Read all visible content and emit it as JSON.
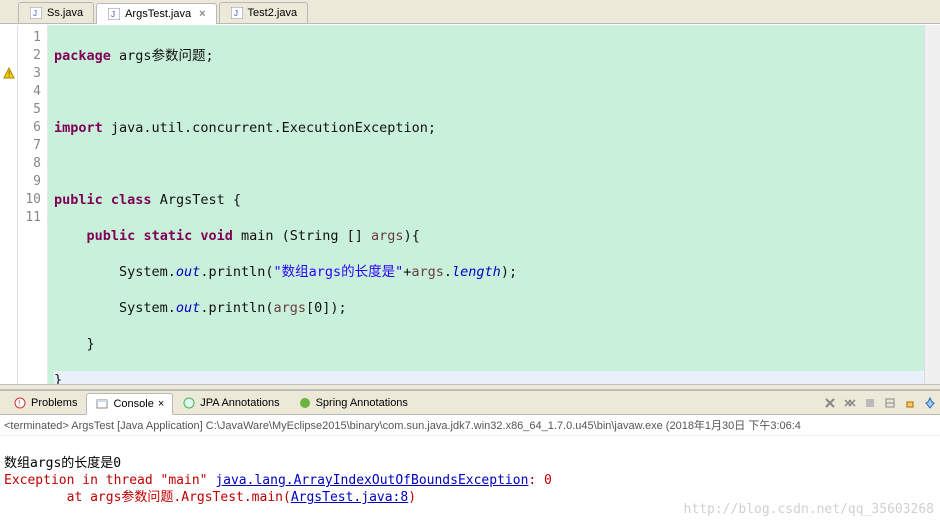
{
  "tabs": [
    {
      "label": "Ss.java",
      "active": false
    },
    {
      "label": "ArgsTest.java",
      "active": true
    },
    {
      "label": "Test2.java",
      "active": false
    }
  ],
  "gutter": [
    "1",
    "2",
    "3",
    "4",
    "5",
    "6",
    "7",
    "8",
    "9",
    "10",
    "11"
  ],
  "code": {
    "l1_kw1": "package",
    "l1_rest": " args参数问题;",
    "l3_kw1": "import",
    "l3_rest": " java.util.concurrent.ExecutionException;",
    "l5_kw1": "public",
    "l5_kw2": "class",
    "l5_rest1": " ArgsTest {",
    "l6_kw1": "public",
    "l6_kw2": "static",
    "l6_kw3": "void",
    "l6_rest1": " main (String [] ",
    "l6_var": "args",
    "l6_rest2": "){",
    "l7_pre": "        System.",
    "l7_fld": "out",
    "l7_mid": ".println(",
    "l7_str": "\"数组args的长度是\"",
    "l7_plus": "+",
    "l7_var": "args",
    "l7_mid2": ".",
    "l7_fld2": "length",
    "l7_end": ");",
    "l8_pre": "        System.",
    "l8_fld": "out",
    "l8_mid": ".println(",
    "l8_var": "args",
    "l8_end": "[0]);",
    "l9": "    }",
    "l10": "}"
  },
  "panel_tabs": {
    "problems": "Problems",
    "console": "Console",
    "jpa": "JPA Annotations",
    "spring": "Spring Annotations"
  },
  "terminated_line": "<terminated> ArgsTest [Java Application] C:\\JavaWare\\MyEclipse2015\\binary\\com.sun.java.jdk7.win32.x86_64_1.7.0.u45\\bin\\javaw.exe (2018年1月30日 下午3:06:4",
  "console": {
    "line1": "数组args的长度是0",
    "exc_prefix": "Exception in thread \"main\" ",
    "exc_link": "java.lang.ArrayIndexOutOfBoundsException",
    "exc_suffix": ": 0",
    "at_prefix": "\tat args参数问题.ArgsTest.main(",
    "at_link": "ArgsTest.java:8",
    "at_suffix": ")"
  },
  "watermark": "http://blog.csdn.net/qq_35603268"
}
